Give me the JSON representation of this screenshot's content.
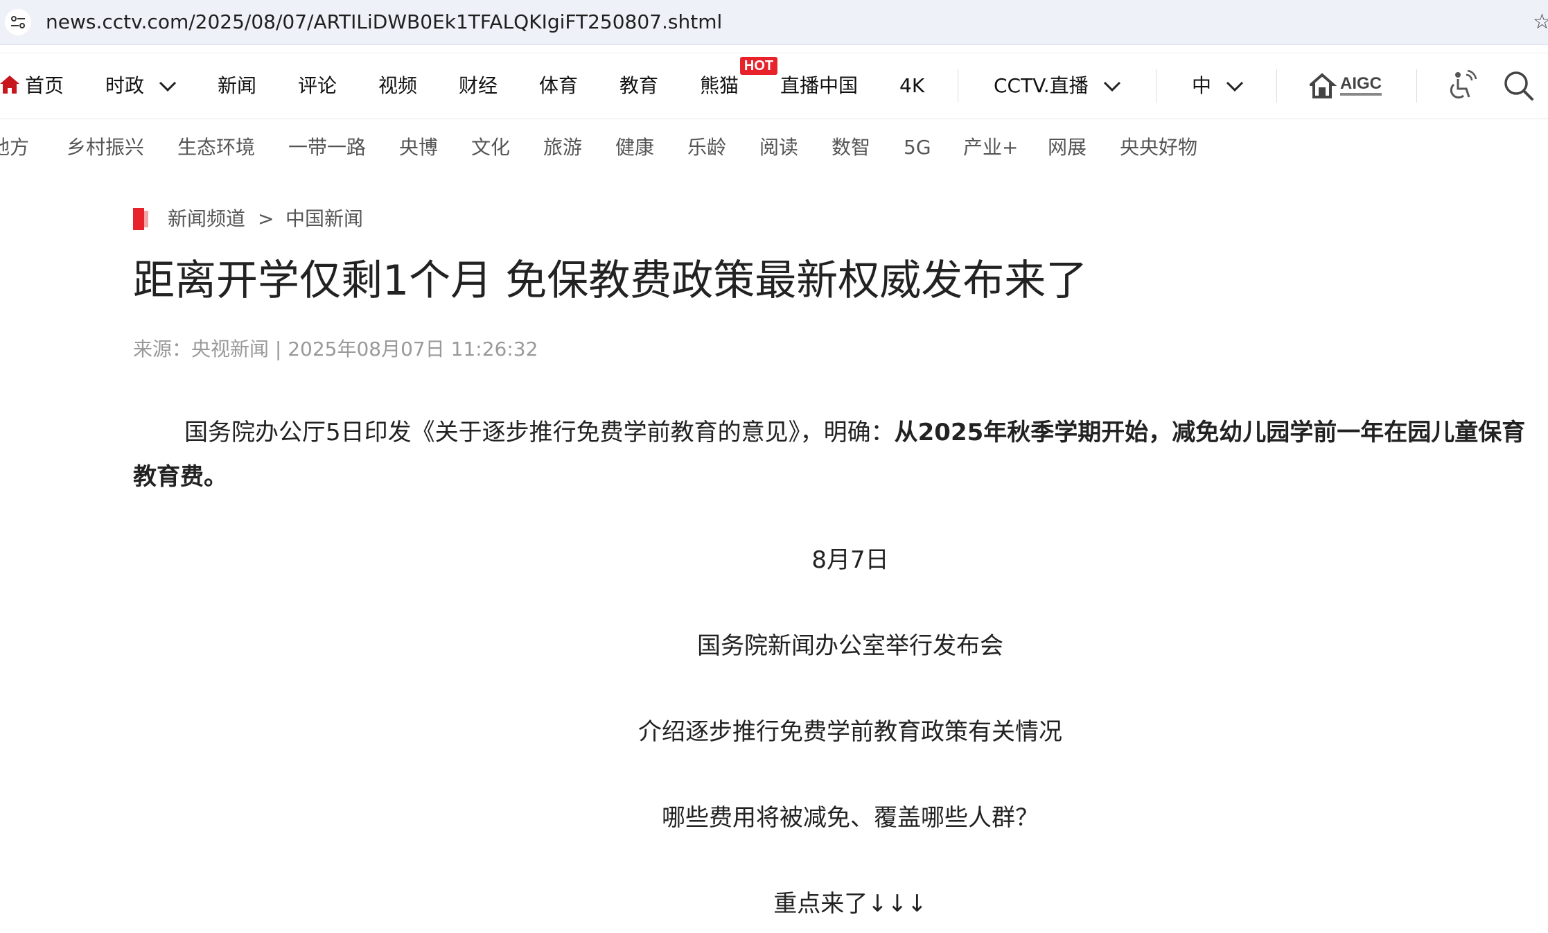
{
  "browser": {
    "url": "news.cctv.com/2025/08/07/ARTILiDWB0Ek1TFALQKIgiFT250807.shtml",
    "star_glyph": "☆"
  },
  "topnav": {
    "items": [
      "首页",
      "时政",
      "新闻",
      "评论",
      "视频",
      "财经",
      "体育",
      "教育",
      "熊猫",
      "直播中国",
      "4K",
      "CCTV.直播",
      "中"
    ],
    "hot_badge": "HOT"
  },
  "subnav": {
    "items": [
      "地方",
      "乡村振兴",
      "生态环境",
      "一带一路",
      "央博",
      "文化",
      "旅游",
      "健康",
      "乐龄",
      "阅读",
      "数智",
      "5G",
      "产业+",
      "网展",
      "央央好物"
    ]
  },
  "breadcrumb": {
    "level1": "新闻频道",
    "separator": ">",
    "level2": "中国新闻"
  },
  "article": {
    "title": "距离开学仅剩1个月 免保教费政策最新权威发布来了",
    "meta": "来源：央视新闻 | 2025年08月07日 11:26:32",
    "para1_normal": "国务院办公厅5日印发《关于逐步推行免费学前教育的意见》，明确：",
    "para1_bold": "从2025年秋季学期开始，减免幼儿园学前一年在园儿童保育教育费。",
    "center_lines": [
      "8月7日",
      "国务院新闻办公室举行发布会",
      "介绍逐步推行免费学前教育政策有关情况",
      "哪些费用将被减免、覆盖哪些人群？",
      "重点来了↓↓↓"
    ]
  },
  "colors": {
    "accent_red": "#e8222a",
    "address_bar_bg": "#eef1f8",
    "meta_gray": "#999999"
  },
  "icons": [
    "tune-icon",
    "star-icon",
    "home-icon",
    "chevron-down-icon",
    "aigc-logo",
    "accessibility-icon",
    "search-icon",
    "breadcrumb-mark-icon"
  ]
}
